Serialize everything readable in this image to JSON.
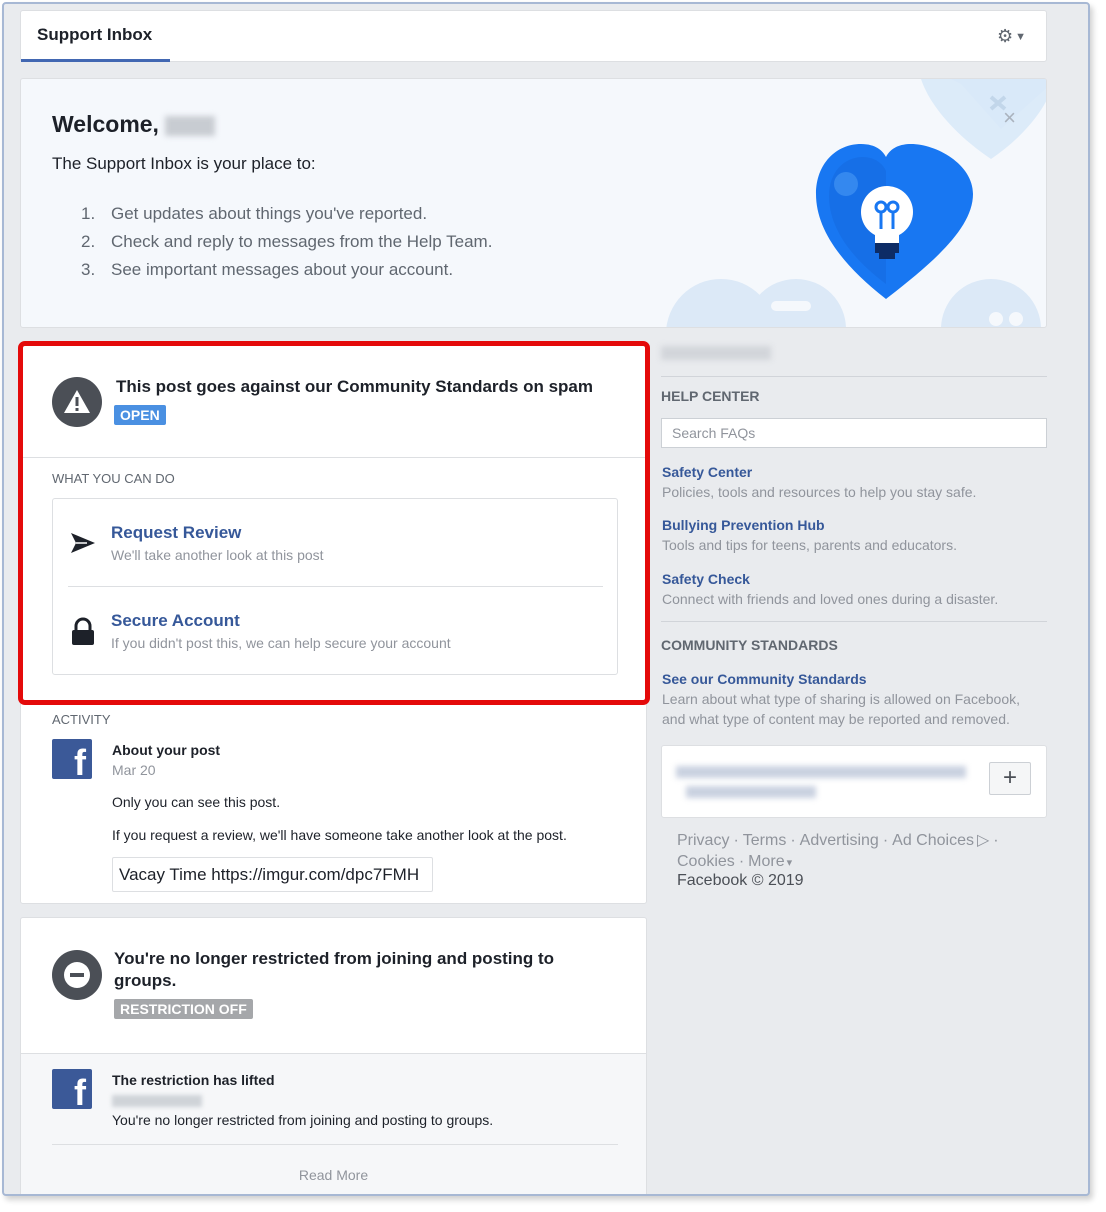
{
  "header": {
    "tab_label": "Support Inbox",
    "settings_caret": "▼"
  },
  "welcome": {
    "greeting": "Welcome,",
    "intro": "The Support Inbox is your place to:",
    "items": [
      {
        "num": "1.",
        "text": "Get updates about things you've reported."
      },
      {
        "num": "2.",
        "text": "Check and reply to messages from the Help Team."
      },
      {
        "num": "3.",
        "text": "See important messages about your account."
      }
    ],
    "close_glyph": "×"
  },
  "spam_card": {
    "title": "This post goes against our Community Standards on spam",
    "status": "OPEN",
    "what_label": "WHAT YOU CAN DO",
    "actions": [
      {
        "title": "Request Review",
        "sub": "We'll take another look at this post",
        "icon": "send-icon"
      },
      {
        "title": "Secure Account",
        "sub": "If you didn't post this, we can help secure your account",
        "icon": "lock-icon"
      }
    ],
    "activity_label": "ACTIVITY",
    "activity": {
      "title": "About your post",
      "date": "Mar 20",
      "line1": "Only you can see this post.",
      "line2": "If you request a review, we'll have someone take another look at the post.",
      "post_text": "Vacay Time https://imgur.com/dpc7FMH"
    }
  },
  "restrict_card": {
    "title": "You're no longer restricted from joining and posting to groups.",
    "status": "RESTRICTION OFF",
    "activity": {
      "title": "The restriction has lifted",
      "text": "You're no longer restricted from joining and posting to groups."
    },
    "read_more": "Read More"
  },
  "sidebar": {
    "help_center_heading": "HELP CENTER",
    "search_placeholder": "Search FAQs",
    "links": [
      {
        "title": "Safety Center",
        "desc": "Policies, tools and resources to help you stay safe."
      },
      {
        "title": "Bullying Prevention Hub",
        "desc": "Tools and tips for teens, parents and educators."
      },
      {
        "title": "Safety Check",
        "desc": "Connect with friends and loved ones during a disaster."
      }
    ],
    "community_heading": "COMMUNITY STANDARDS",
    "community_link": "See our Community Standards",
    "community_desc_1": "Learn about what type of sharing is allowed on Facebook,",
    "community_desc_2": "and what type of content may be reported and removed.",
    "plus_label": "+"
  },
  "footer": {
    "links": [
      "Privacy",
      "Terms",
      "Advertising",
      "Ad Choices",
      "Cookies",
      "More"
    ],
    "more_caret": "▾",
    "copyright": "Facebook © 2019"
  },
  "colors": {
    "brand_blue": "#4267b2",
    "link_blue": "#365899",
    "open_badge": "#4a90e2",
    "highlight_red": "#e40a0a"
  }
}
